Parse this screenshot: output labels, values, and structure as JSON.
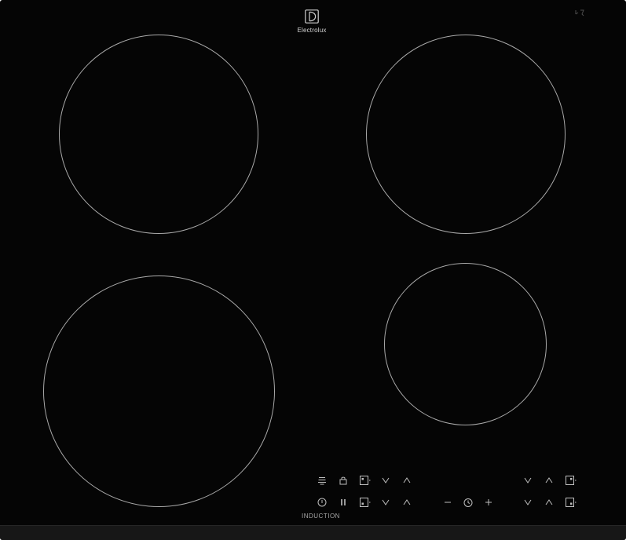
{
  "appliance": {
    "brand": "Electrolux",
    "logo_icon": "electrolux-logo-icon",
    "type_label": "INDUCTION",
    "surface_color": "#050505",
    "zone_line_color": "#a9a9a9",
    "control_color": "#bfbfbf"
  },
  "controls": {
    "row1": [
      "bridge-icon",
      "lock-icon",
      "zone-select-icon",
      "down-arrow-icon",
      "up-arrow-icon",
      "down-arrow-icon",
      "up-arrow-icon",
      "zone-select-icon"
    ],
    "row2": [
      "power-icon",
      "pause-icon",
      "zone-select-icon",
      "down-arrow-icon",
      "up-arrow-icon",
      "minus-icon",
      "timer-icon",
      "plus-icon",
      "down-arrow-icon",
      "up-arrow-icon",
      "zone-select-icon"
    ]
  }
}
